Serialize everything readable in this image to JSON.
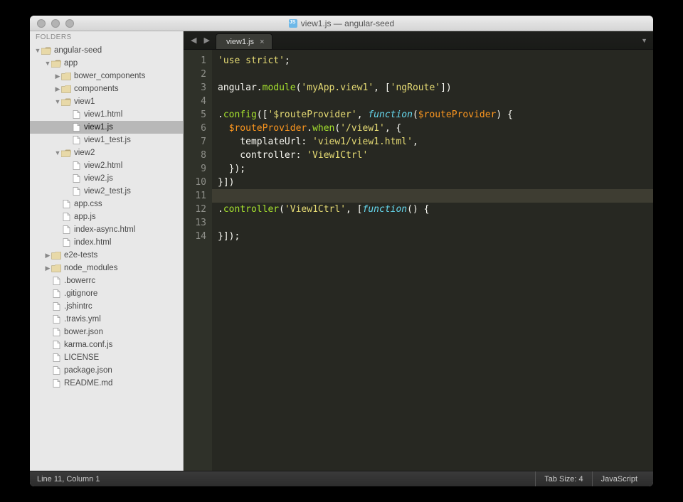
{
  "window_title": "view1.js — angular-seed",
  "sidebar": {
    "header": "FOLDERS",
    "tree": [
      {
        "d": 0,
        "t": "folder-open",
        "l": "angular-seed",
        "a": "down"
      },
      {
        "d": 1,
        "t": "folder-open",
        "l": "app",
        "a": "down"
      },
      {
        "d": 2,
        "t": "folder",
        "l": "bower_components",
        "a": "right"
      },
      {
        "d": 2,
        "t": "folder",
        "l": "components",
        "a": "right"
      },
      {
        "d": 2,
        "t": "folder-open",
        "l": "view1",
        "a": "down"
      },
      {
        "d": 3,
        "t": "file",
        "l": "view1.html"
      },
      {
        "d": 3,
        "t": "file",
        "l": "view1.js",
        "sel": true
      },
      {
        "d": 3,
        "t": "file",
        "l": "view1_test.js"
      },
      {
        "d": 2,
        "t": "folder-open",
        "l": "view2",
        "a": "down"
      },
      {
        "d": 3,
        "t": "file",
        "l": "view2.html"
      },
      {
        "d": 3,
        "t": "file",
        "l": "view2.js"
      },
      {
        "d": 3,
        "t": "file",
        "l": "view2_test.js"
      },
      {
        "d": 2,
        "t": "file",
        "l": "app.css"
      },
      {
        "d": 2,
        "t": "file",
        "l": "app.js"
      },
      {
        "d": 2,
        "t": "file",
        "l": "index-async.html"
      },
      {
        "d": 2,
        "t": "file",
        "l": "index.html"
      },
      {
        "d": 1,
        "t": "folder",
        "l": "e2e-tests",
        "a": "right"
      },
      {
        "d": 1,
        "t": "folder",
        "l": "node_modules",
        "a": "right"
      },
      {
        "d": 1,
        "t": "file",
        "l": ".bowerrc"
      },
      {
        "d": 1,
        "t": "file",
        "l": ".gitignore"
      },
      {
        "d": 1,
        "t": "file",
        "l": ".jshintrc"
      },
      {
        "d": 1,
        "t": "file",
        "l": ".travis.yml"
      },
      {
        "d": 1,
        "t": "file",
        "l": "bower.json"
      },
      {
        "d": 1,
        "t": "file",
        "l": "karma.conf.js"
      },
      {
        "d": 1,
        "t": "file",
        "l": "LICENSE"
      },
      {
        "d": 1,
        "t": "file",
        "l": "package.json"
      },
      {
        "d": 1,
        "t": "file",
        "l": "README.md"
      }
    ]
  },
  "tab": {
    "label": "view1.js"
  },
  "code": {
    "lines": [
      [
        {
          "c": "s-str",
          "t": "'use strict'"
        },
        {
          "c": "",
          "t": ";"
        }
      ],
      [],
      [
        {
          "c": "",
          "t": "angular."
        },
        {
          "c": "s-fn",
          "t": "module"
        },
        {
          "c": "",
          "t": "("
        },
        {
          "c": "s-str",
          "t": "'myApp.view1'"
        },
        {
          "c": "",
          "t": ", ["
        },
        {
          "c": "s-str",
          "t": "'ngRoute'"
        },
        {
          "c": "",
          "t": "])"
        }
      ],
      [],
      [
        {
          "c": "",
          "t": "."
        },
        {
          "c": "s-fn",
          "t": "config"
        },
        {
          "c": "",
          "t": "(["
        },
        {
          "c": "s-str",
          "t": "'$routeProvider'"
        },
        {
          "c": "",
          "t": ", "
        },
        {
          "c": "s-kw",
          "t": "function"
        },
        {
          "c": "",
          "t": "("
        },
        {
          "c": "s-id",
          "t": "$routeProvider"
        },
        {
          "c": "",
          "t": ") {"
        }
      ],
      [
        {
          "c": "",
          "t": "  "
        },
        {
          "c": "s-id",
          "t": "$routeProvider"
        },
        {
          "c": "",
          "t": "."
        },
        {
          "c": "s-fn",
          "t": "when"
        },
        {
          "c": "",
          "t": "("
        },
        {
          "c": "s-str",
          "t": "'/view1'"
        },
        {
          "c": "",
          "t": ", {"
        }
      ],
      [
        {
          "c": "",
          "t": "    templateUrl: "
        },
        {
          "c": "s-str",
          "t": "'view1/view1.html'"
        },
        {
          "c": "",
          "t": ","
        }
      ],
      [
        {
          "c": "",
          "t": "    controller: "
        },
        {
          "c": "s-str",
          "t": "'View1Ctrl'"
        }
      ],
      [
        {
          "c": "",
          "t": "  });"
        }
      ],
      [
        {
          "c": "",
          "t": "}])"
        }
      ],
      [],
      [
        {
          "c": "",
          "t": "."
        },
        {
          "c": "s-fn",
          "t": "controller"
        },
        {
          "c": "",
          "t": "("
        },
        {
          "c": "s-str",
          "t": "'View1Ctrl'"
        },
        {
          "c": "",
          "t": ", ["
        },
        {
          "c": "s-kw",
          "t": "function"
        },
        {
          "c": "",
          "t": "() {"
        }
      ],
      [],
      [
        {
          "c": "",
          "t": "}]);"
        }
      ]
    ],
    "current_line": 11
  },
  "status": {
    "position": "Line 11, Column 1",
    "tabsize": "Tab Size: 4",
    "language": "JavaScript"
  }
}
